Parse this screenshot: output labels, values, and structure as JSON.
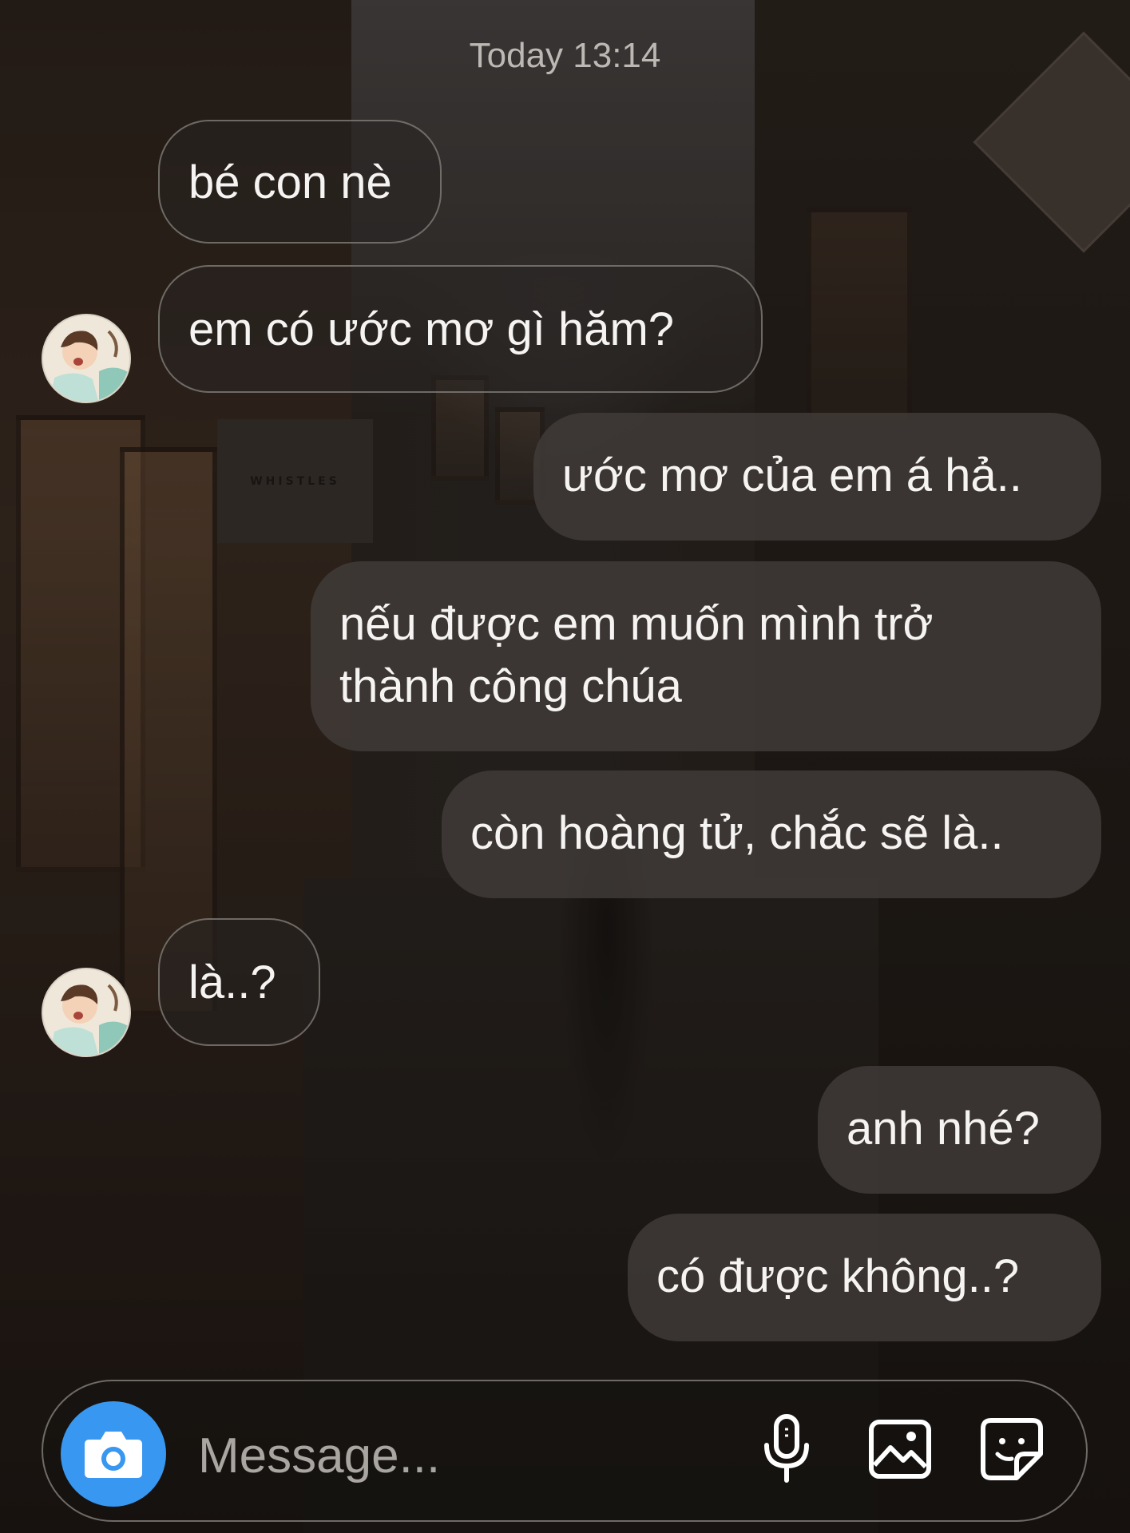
{
  "chat": {
    "timestamp": "Today 13:14",
    "messages": [
      {
        "id": "m1",
        "sender": "them",
        "text": "bé con nè"
      },
      {
        "id": "m2",
        "sender": "them",
        "text": "em có ước mơ gì hăm?"
      },
      {
        "id": "m3",
        "sender": "me",
        "text": "ước mơ của em á hả.."
      },
      {
        "id": "m4",
        "sender": "me",
        "line1": "nếu được em muốn mình trở",
        "line2": "thành công chúa"
      },
      {
        "id": "m5",
        "sender": "me",
        "text": "còn hoàng tử, chắc sẽ là.."
      },
      {
        "id": "m6",
        "sender": "them",
        "text": "là..?"
      },
      {
        "id": "m7",
        "sender": "me",
        "text": "anh nhé?"
      },
      {
        "id": "m8",
        "sender": "me",
        "text": "có được không..?"
      }
    ]
  },
  "composer": {
    "placeholder": "Message...",
    "icons": {
      "camera": "camera-icon",
      "mic": "microphone-icon",
      "gallery": "image-icon",
      "sticker": "sticker-icon"
    },
    "camera_color": "#3897f0"
  }
}
